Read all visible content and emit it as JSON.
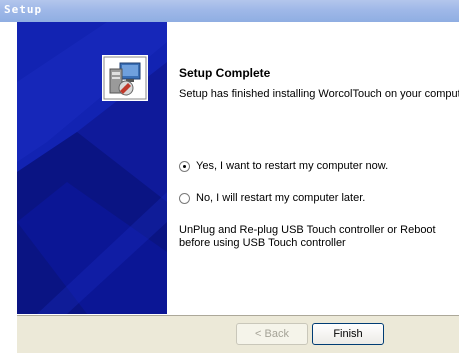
{
  "window": {
    "title": "Setup"
  },
  "content": {
    "heading": "Setup Complete",
    "description": "Setup has finished installing WorcolTouch on your computer.",
    "options": [
      {
        "label": "Yes, I want to restart my computer now.",
        "selected": true
      },
      {
        "label": "No, I will restart my computer later.",
        "selected": false
      }
    ],
    "note": "UnPlug and Re-plug USB Touch controller or Reboot before using USB Touch controller"
  },
  "buttons": {
    "back_label": "< Back",
    "finish_label": "Finish"
  },
  "colors": {
    "sidebar": "#0f1a9a",
    "titlebar": "#9fb8e8",
    "button_bar": "#ece9d8"
  },
  "icons": {
    "setup": "setup-installer-icon"
  }
}
